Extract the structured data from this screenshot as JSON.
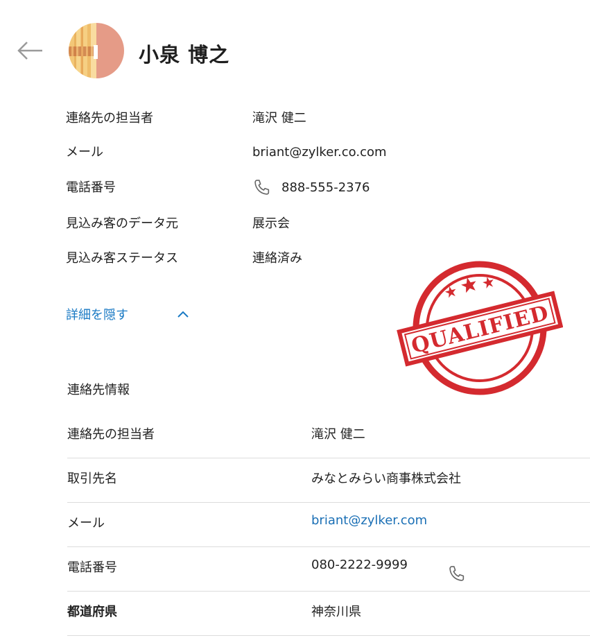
{
  "header": {
    "back_icon": "arrow-left-icon",
    "name": "小泉 博之"
  },
  "summary": {
    "fields": [
      {
        "label": "連絡先の担当者",
        "value": "滝沢 健二"
      },
      {
        "label": "メール",
        "value": "briant@zylker.co.com"
      },
      {
        "label": "電話番号",
        "value": "888-555-2376",
        "icon": "phone-icon"
      },
      {
        "label": "見込み客のデータ元",
        "value": "展示会"
      },
      {
        "label": "見込み客ステータス",
        "value": "連絡済み"
      }
    ],
    "toggle_label": "詳細を隠す",
    "toggle_icon": "chevron-up-icon"
  },
  "stamp": {
    "text": "QUALIFIED",
    "color": "#d42a2f"
  },
  "details": {
    "section_title": "連絡先情報",
    "rows": [
      {
        "label": "連絡先の担当者",
        "value": "滝沢 健二"
      },
      {
        "label": "取引先名",
        "value": "みなとみらい商事株式会社"
      },
      {
        "label": "メール",
        "value": "briant@zylker.com"
      },
      {
        "label": "電話番号",
        "value": "080-2222-9999",
        "icon": "phone-icon"
      },
      {
        "label": "都道府県",
        "value": "神奈川県"
      }
    ]
  },
  "colors": {
    "link": "#1a6fb5",
    "accent": "#1a7ac4",
    "divider": "#dcdcdc"
  }
}
